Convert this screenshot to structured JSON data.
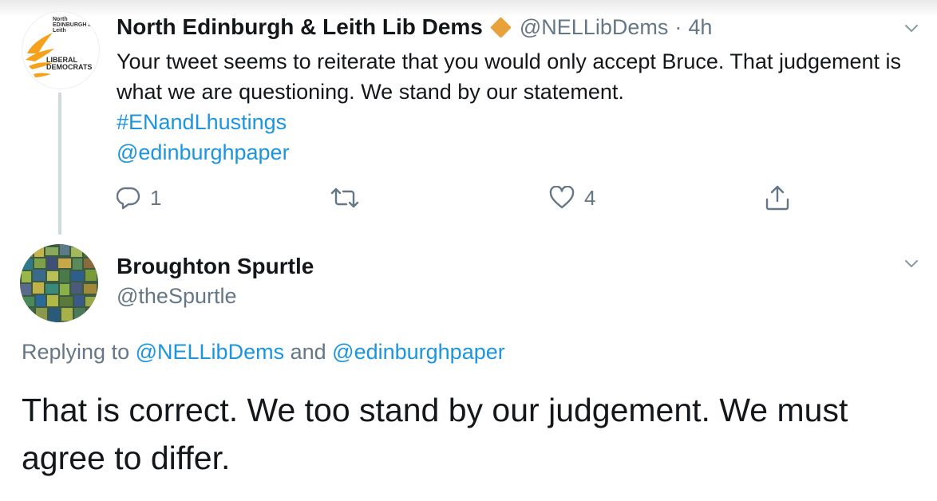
{
  "tweet1": {
    "author_name": "North Edinburgh & Leith Lib Dems",
    "handle": "@NELLibDems",
    "separator": "·",
    "time": "4h",
    "avatar": {
      "small_text": "North EDINBURGH and Leith",
      "logo_text": "LIBERAL DEMOCRATS",
      "brand_color": "#f6a11b"
    },
    "text": "Your tweet seems to reiterate that you would only accept Bruce. That judgement is what we are questioning. We stand by our statement.",
    "hashtag": "#ENandLhustings",
    "mention": "@edinburghpaper",
    "actions": {
      "reply_icon": "reply-icon",
      "reply_count": "1",
      "retweet_icon": "retweet-icon",
      "like_icon": "heart-icon",
      "like_count": "4",
      "share_icon": "share-icon"
    }
  },
  "tweet2": {
    "author_name": "Broughton Spurtle",
    "handle": "@theSpurtle",
    "replying_prefix": "Replying to",
    "replying_to_1": "@NELLibDems",
    "replying_joiner": "and",
    "replying_to_2": "@edinburghpaper",
    "text": "That is correct. We too stand by our judgement. We must agree to differ."
  },
  "colors": {
    "link": "#1b95e0",
    "secondary_text": "#657786",
    "primary_text": "#14171a",
    "verified_badge": "#e9a23b",
    "thread_line": "#cfd9de"
  }
}
